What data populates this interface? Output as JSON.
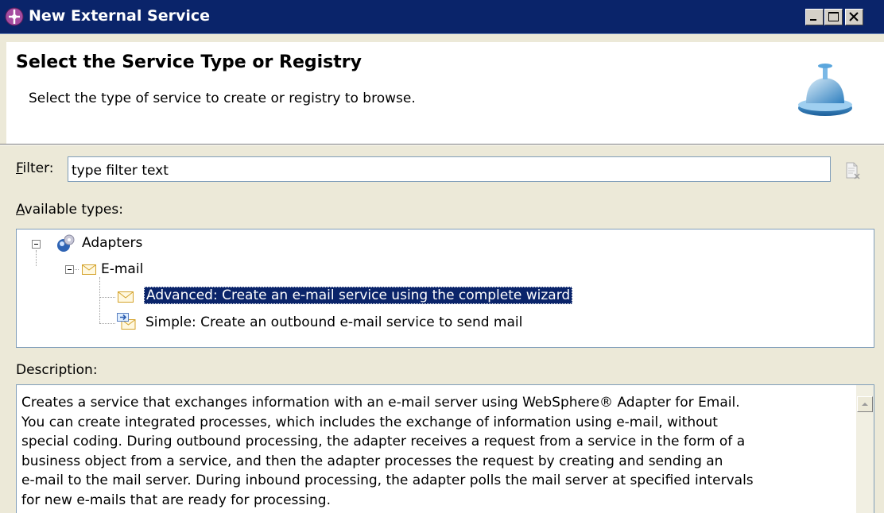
{
  "window": {
    "title": "New External Service",
    "controls": [
      "minimize",
      "maximize",
      "close"
    ]
  },
  "banner": {
    "title": "Select the Service Type or Registry",
    "description": "Select the type of service to create or registry to browse.",
    "icon": "service-bell-icon"
  },
  "filter": {
    "label": "Filter:",
    "mnemonic": "F",
    "label_rest": "ilter:",
    "value": "type filter text",
    "clear_icon": "clear-filter-icon"
  },
  "available_types": {
    "label_mnemonic": "A",
    "label_rest": "vailable types:",
    "tree": [
      {
        "label": "Adapters",
        "icon": "adapters-icon",
        "expanded": true,
        "children": [
          {
            "label": "E-mail",
            "icon": "envelope-icon",
            "expanded": true,
            "children": [
              {
                "label": "Advanced: Create an e-mail service using the complete wizard",
                "icon": "envelope-icon",
                "selected": true
              },
              {
                "label": "Simple: Create an outbound e-mail service to send mail",
                "icon": "outbound-mail-icon",
                "selected": false
              }
            ]
          }
        ]
      }
    ]
  },
  "description": {
    "label": "Description:",
    "lines": [
      "Creates a service that exchanges information with an e-mail server using WebSphere® Adapter for Email.",
      "You can create integrated processes, which includes the exchange of information using e-mail, without",
      "special coding. During outbound processing, the adapter receives a request from a service in the form of a",
      "business object from a service, and then the adapter processes the request by creating and sending an",
      "e-mail to the mail server. During inbound processing, the adapter polls the mail server at specified intervals",
      "for new e-mails that are ready for processing."
    ]
  },
  "colors": {
    "titlebar": "#0a246a",
    "selection": "#0a246a",
    "dialog_bg": "#ece9d8",
    "border": "#7f9db9"
  }
}
